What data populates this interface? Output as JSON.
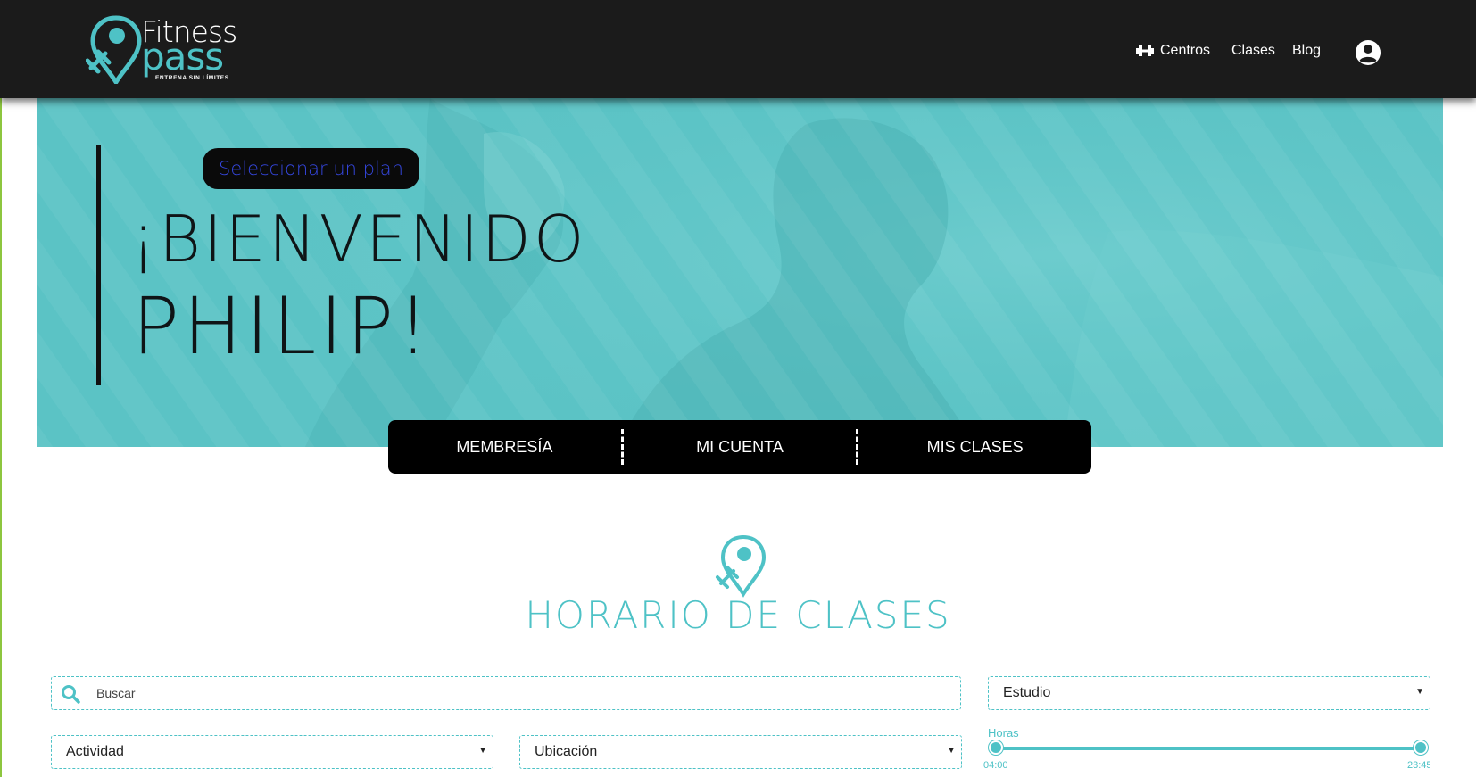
{
  "header": {
    "logo": {
      "word_1": "Fitness",
      "word_2": "pass",
      "tagline": "ENTRENA SIN LÍMITES"
    },
    "nav": {
      "centros_label": "Centros",
      "clases_label": "Clases",
      "blog_label": "Blog"
    }
  },
  "hero": {
    "plan_button_label": "Seleccionar un plan",
    "welcome_line_1": "¡BIENVENIDO",
    "welcome_line_2": "PHILIP!"
  },
  "tabs": [
    {
      "label": "MEMBRESÍA"
    },
    {
      "label": "MI CUENTA"
    },
    {
      "label": "MIS CLASES"
    }
  ],
  "schedule": {
    "title": "HORARIO DE CLASES",
    "search": {
      "placeholder": "Buscar",
      "value": ""
    },
    "estudio_select": {
      "selected": "Estudio"
    },
    "actividad_select": {
      "selected": "Actividad"
    },
    "ubicacion_select": {
      "selected": "Ubicación"
    },
    "hours": {
      "label": "Horas",
      "min": "04:00",
      "max": "23:45"
    }
  },
  "colors": {
    "accent": "#4ec2c6",
    "header_bg": "#1b1b1b",
    "hero_bg": "#5ec6c8",
    "plan_button_text": "#3547e0",
    "page_edge": "#8dc63f"
  }
}
